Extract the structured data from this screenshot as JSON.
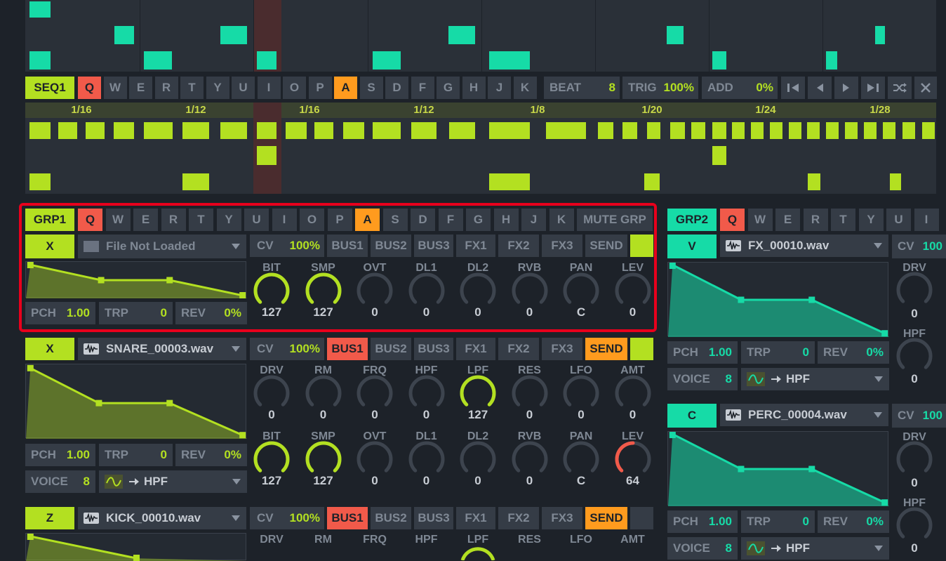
{
  "seq_top_bar": {
    "seq_label": "SEQ1",
    "keys": [
      "Q",
      "W",
      "E",
      "R",
      "T",
      "Y",
      "U",
      "I",
      "O",
      "P",
      "A",
      "S",
      "D",
      "F",
      "G",
      "H",
      "J",
      "K"
    ],
    "beat_label": "BEAT",
    "beat_value": "8",
    "trig_label": "TRIG",
    "trig_value": "100%",
    "add_label": "ADD",
    "add_value": "0%"
  },
  "seq_divisions": [
    "1/16",
    "1/12",
    "1/16",
    "1/12",
    "1/8",
    "1/20",
    "1/24",
    "1/28"
  ],
  "grp1": {
    "label": "GRP1",
    "keys": [
      "Q",
      "W",
      "E",
      "R",
      "T",
      "Y",
      "U",
      "I",
      "O",
      "P",
      "A",
      "S",
      "D",
      "F",
      "G",
      "H",
      "J",
      "K"
    ],
    "mute": "MUTE GRP"
  },
  "grp2": {
    "label": "GRP2",
    "keys": [
      "Q",
      "W",
      "E",
      "R",
      "T",
      "Y",
      "U",
      "I"
    ]
  },
  "track1": {
    "key": "X",
    "file": "File Not Loaded",
    "cv_label": "CV",
    "cv_value": "100%",
    "bus": [
      "BUS1",
      "BUS2",
      "BUS3",
      "FX1",
      "FX2",
      "FX3",
      "SEND"
    ],
    "pch_label": "PCH",
    "pch_value": "1.00",
    "trp_label": "TRP",
    "trp_value": "0",
    "rev_label": "REV",
    "rev_value": "0%",
    "knobs": [
      {
        "label": "BIT",
        "value": "127"
      },
      {
        "label": "SMP",
        "value": "127"
      },
      {
        "label": "OVT",
        "value": "0"
      },
      {
        "label": "DL1",
        "value": "0"
      },
      {
        "label": "DL2",
        "value": "0"
      },
      {
        "label": "RVB",
        "value": "0"
      },
      {
        "label": "PAN",
        "value": "C"
      },
      {
        "label": "LEV",
        "value": "0"
      }
    ]
  },
  "track2": {
    "key": "X",
    "file": "SNARE_00003.wav",
    "cv_label": "CV",
    "cv_value": "100%",
    "bus": [
      "BUS1",
      "BUS2",
      "BUS3",
      "FX1",
      "FX2",
      "FX3",
      "SEND"
    ],
    "pch_label": "PCH",
    "pch_value": "1.00",
    "trp_label": "TRP",
    "trp_value": "0",
    "rev_label": "REV",
    "rev_value": "0%",
    "voice_label": "VOICE",
    "voice_value": "8",
    "filter": "HPF",
    "knobs1": [
      {
        "label": "DRV",
        "value": "0"
      },
      {
        "label": "RM",
        "value": "0"
      },
      {
        "label": "FRQ",
        "value": "0"
      },
      {
        "label": "HPF",
        "value": "0"
      },
      {
        "label": "LPF",
        "value": "127"
      },
      {
        "label": "RES",
        "value": "0"
      },
      {
        "label": "LFO",
        "value": "0"
      },
      {
        "label": "AMT",
        "value": "0"
      }
    ],
    "knobs2": [
      {
        "label": "BIT",
        "value": "127"
      },
      {
        "label": "SMP",
        "value": "127"
      },
      {
        "label": "OVT",
        "value": "0"
      },
      {
        "label": "DL1",
        "value": "0"
      },
      {
        "label": "DL2",
        "value": "0"
      },
      {
        "label": "RVB",
        "value": "0"
      },
      {
        "label": "PAN",
        "value": "C"
      },
      {
        "label": "LEV",
        "value": "64"
      }
    ]
  },
  "track3": {
    "key": "Z",
    "file": "KICK_00010.wav",
    "cv_label": "CV",
    "cv_value": "100%",
    "bus": [
      "BUS1",
      "BUS2",
      "BUS3",
      "FX1",
      "FX2",
      "FX3",
      "SEND"
    ],
    "knobs": [
      {
        "label": "DRV"
      },
      {
        "label": "RM"
      },
      {
        "label": "FRQ"
      },
      {
        "label": "HPF"
      },
      {
        "label": "LPF"
      },
      {
        "label": "RES"
      },
      {
        "label": "LFO"
      },
      {
        "label": "AMT"
      }
    ]
  },
  "track4": {
    "key": "V",
    "file": "FX_00010.wav",
    "cv_label": "CV",
    "cv_value": "100",
    "pch_label": "PCH",
    "pch_value": "1.00",
    "trp_label": "TRP",
    "trp_value": "0",
    "rev_label": "REV",
    "rev_value": "0%",
    "voice_label": "VOICE",
    "voice_value": "8",
    "filter": "HPF",
    "drv_label": "DRV",
    "drv_value": "0",
    "hpf_label": "HPF",
    "hpf_value": "0"
  },
  "track5": {
    "key": "C",
    "file": "PERC_00004.wav",
    "cv_label": "CV",
    "cv_value": "100",
    "pch_label": "PCH",
    "pch_value": "1.00",
    "trp_label": "TRP",
    "trp_value": "0",
    "rev_label": "REV",
    "rev_value": "0%",
    "voice_label": "VOICE",
    "voice_value": "8",
    "filter": "HPF",
    "drv_label": "DRV",
    "drv_value": "0",
    "hpf_label": "HPF",
    "hpf_value": "0"
  },
  "colors": {
    "lime": "#b3e021",
    "teal": "#16dba7",
    "red": "#f15a4a",
    "orange": "#ff9b1e",
    "highlight": "#e8001c"
  }
}
